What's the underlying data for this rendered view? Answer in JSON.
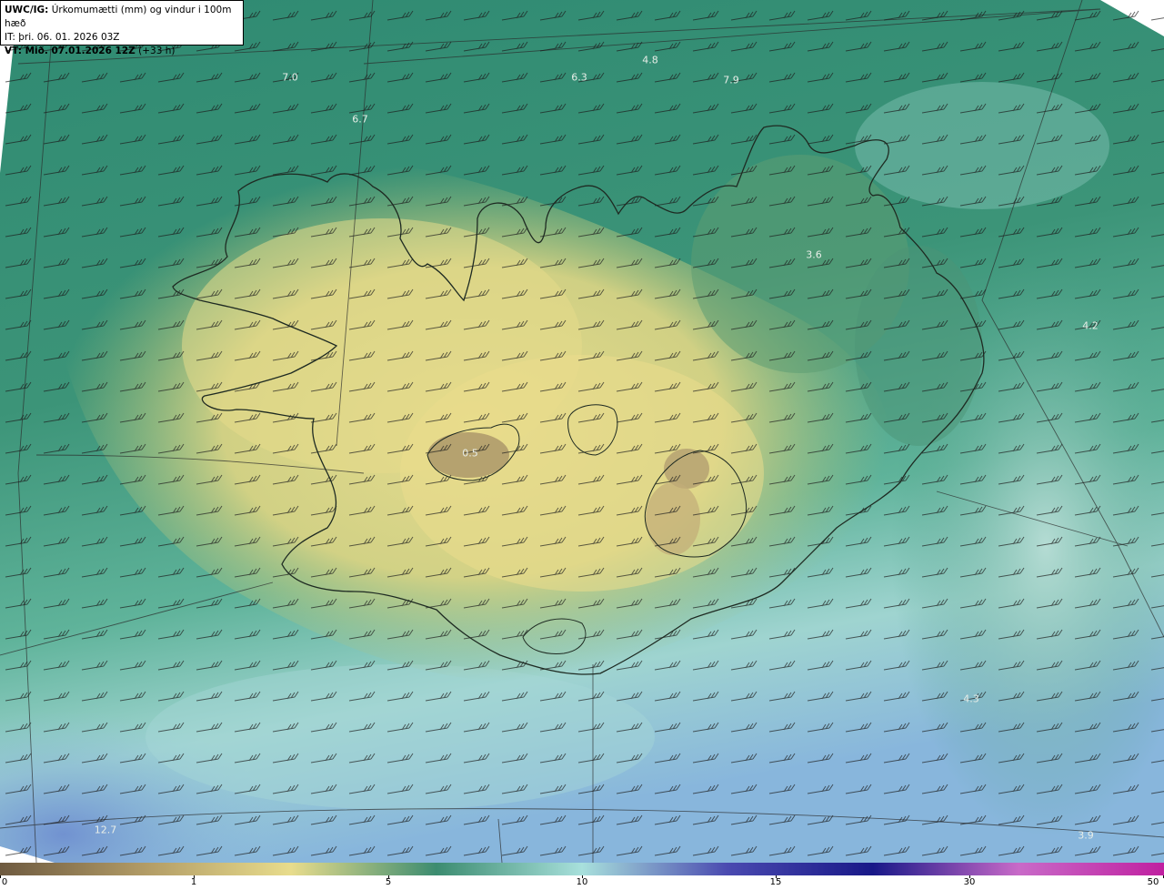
{
  "header": {
    "line1_bold": "UWC/IG:",
    "line1_rest": " Úrkomumætti (mm) og vindur i 100m hæð",
    "line2": "IT: þri. 06. 01. 2026 03Z",
    "line3_bold": "VT: Mið. 07.01.2026 12Z",
    "line3_rest": " (+33 h)"
  },
  "map_labels": [
    {
      "text": "7.0",
      "name": "value-label-7-0"
    },
    {
      "text": "6.7",
      "name": "value-label-6-7"
    },
    {
      "text": "6.3",
      "name": "value-label-6-3"
    },
    {
      "text": "4.8",
      "name": "value-label-4-8"
    },
    {
      "text": "7.9",
      "name": "value-label-7-9"
    },
    {
      "text": "3.6",
      "name": "value-label-3-6"
    },
    {
      "text": "4.2",
      "name": "value-label-4-2"
    },
    {
      "text": "0.5",
      "name": "value-label-0-5"
    },
    {
      "text": "4.3",
      "name": "value-label-4-3"
    },
    {
      "text": "12.7",
      "name": "value-label-12-7"
    },
    {
      "text": "3.9",
      "name": "value-label-3-9"
    }
  ],
  "colorbar": {
    "ticks": [
      "0",
      "1",
      "5",
      "10",
      "15",
      "30",
      "50"
    ],
    "colors": [
      "#6e5a40",
      "#b29c66",
      "#e8dc8c",
      "#3c8c70",
      "#a8e0dc",
      "#4a4ab0",
      "#181888",
      "#c86ac8",
      "#c020a0"
    ]
  }
}
